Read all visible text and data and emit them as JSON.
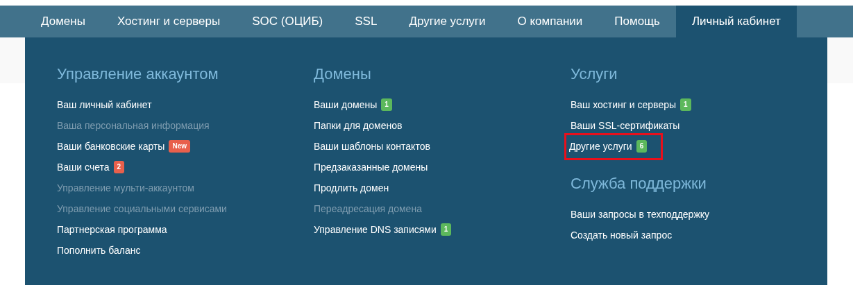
{
  "nav": {
    "tabs": [
      {
        "label": "Домены",
        "selected": false
      },
      {
        "label": "Хостинг и серверы",
        "selected": false
      },
      {
        "label": "SOC (ОЦИБ)",
        "selected": false
      },
      {
        "label": "SSL",
        "selected": false
      },
      {
        "label": "Другие услуги",
        "selected": false
      },
      {
        "label": "О компании",
        "selected": false
      },
      {
        "label": "Помощь",
        "selected": false
      },
      {
        "label": "Личный кабинет",
        "selected": true
      }
    ]
  },
  "dropdown": {
    "columns": [
      {
        "sections": [
          {
            "heading": "Управление аккаунтом",
            "items": [
              {
                "label": "Ваш личный кабинет",
                "disabled": false,
                "highlighted": false
              },
              {
                "label": "Ваша персональная информация",
                "disabled": true,
                "highlighted": false
              },
              {
                "label": "Ваши банковские карты",
                "disabled": false,
                "highlighted": false,
                "badge": {
                  "text": "New",
                  "color": "#e8604c"
                }
              },
              {
                "label": "Ваши счета",
                "disabled": false,
                "highlighted": false,
                "badge": {
                  "text": "2",
                  "color": "#e8604c"
                }
              },
              {
                "label": "Управление мульти-аккаунтом",
                "disabled": true,
                "highlighted": false
              },
              {
                "label": "Управление социальными сервисами",
                "disabled": true,
                "highlighted": false
              },
              {
                "label": "Партнерская программа",
                "disabled": false,
                "highlighted": false
              },
              {
                "label": "Пополнить баланс",
                "disabled": false,
                "highlighted": false
              }
            ]
          }
        ]
      },
      {
        "sections": [
          {
            "heading": "Домены",
            "items": [
              {
                "label": "Ваши домены",
                "disabled": false,
                "highlighted": false,
                "badge": {
                  "text": "1",
                  "color": "#5cb85c"
                }
              },
              {
                "label": "Папки для доменов",
                "disabled": false,
                "highlighted": false
              },
              {
                "label": "Ваши шаблоны контактов",
                "disabled": false,
                "highlighted": false
              },
              {
                "label": "Предзаказанные домены",
                "disabled": false,
                "highlighted": false
              },
              {
                "label": "Продлить домен",
                "disabled": false,
                "highlighted": false
              },
              {
                "label": "Переадресация домена",
                "disabled": true,
                "highlighted": false
              },
              {
                "label": "Управление DNS записями",
                "disabled": false,
                "highlighted": false,
                "badge": {
                  "text": "1",
                  "color": "#5cb85c"
                }
              }
            ]
          }
        ]
      },
      {
        "sections": [
          {
            "heading": "Услуги",
            "items": [
              {
                "label": "Ваш хостинг и серверы",
                "disabled": false,
                "highlighted": false,
                "badge": {
                  "text": "1",
                  "color": "#5cb85c"
                }
              },
              {
                "label": "Ваши SSL-сертификаты",
                "disabled": false,
                "highlighted": false
              },
              {
                "label": "Другие услуги",
                "disabled": false,
                "highlighted": true,
                "badge": {
                  "text": "6",
                  "color": "#5cb85c"
                }
              }
            ]
          },
          {
            "heading": "Служба поддержки",
            "items": [
              {
                "label": "Ваши запросы в техподдержку",
                "disabled": false,
                "highlighted": false
              },
              {
                "label": "Создать новый запрос",
                "disabled": false,
                "highlighted": false
              }
            ]
          }
        ]
      }
    ]
  }
}
